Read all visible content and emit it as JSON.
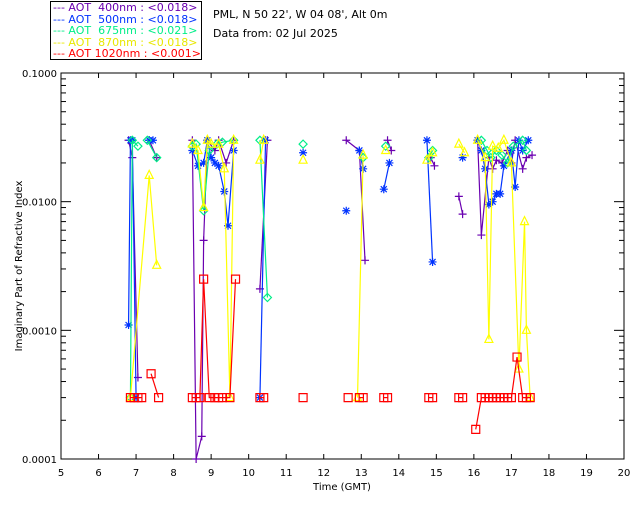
{
  "header": {
    "location": "PML, N 50 22', W 04 08', Alt 0m",
    "date": "Data from: 02 Jul 2025"
  },
  "chart_data": {
    "type": "line",
    "xlabel": "Time (GMT)",
    "ylabel": "Imaginary Part of Refractive Index",
    "xlim": [
      5,
      20
    ],
    "ylim": [
      0.0001,
      0.1
    ],
    "yscale": "log",
    "x_ticks": [
      "5",
      "6",
      "7",
      "8",
      "9",
      "10",
      "11",
      "12",
      "13",
      "14",
      "15",
      "16",
      "17",
      "18",
      "19",
      "20"
    ],
    "y_ticks": [
      "0.0001",
      "0.0010",
      "0.0100",
      "0.1000"
    ],
    "grid": false,
    "legend_placement": "top-left outside",
    "series": [
      {
        "name": "AOT  400nm : <0.018>",
        "color": "#6a00b0",
        "marker": "plus",
        "points": [
          [
            6.8,
            0.03
          ],
          [
            6.9,
            0.022
          ],
          [
            7.05,
            0.00043
          ],
          null,
          [
            7.35,
            0.03
          ],
          [
            7.55,
            0.022
          ],
          null,
          [
            8.5,
            0.03
          ],
          [
            8.6,
            0.0001
          ],
          [
            8.75,
            0.00015
          ],
          [
            8.8,
            0.005
          ],
          [
            8.9,
            0.03
          ],
          [
            9.1,
            0.025
          ],
          [
            9.2,
            0.03
          ],
          [
            9.4,
            0.02
          ],
          [
            9.6,
            0.03
          ],
          null,
          [
            10.3,
            0.0021
          ],
          [
            10.5,
            0.03
          ],
          null,
          [
            12.6,
            0.03
          ],
          [
            12.95,
            0.025
          ],
          [
            13.1,
            0.0035
          ],
          null,
          [
            13.7,
            0.03
          ],
          [
            13.8,
            0.025
          ],
          null,
          [
            14.85,
            0.022
          ],
          [
            14.95,
            0.019
          ],
          null,
          [
            15.6,
            0.011
          ],
          [
            15.7,
            0.008
          ],
          null,
          [
            16.1,
            0.03
          ],
          [
            16.2,
            0.0055
          ],
          [
            16.4,
            0.022
          ],
          [
            16.5,
            0.018
          ],
          [
            16.6,
            0.021
          ],
          [
            16.75,
            0.02
          ],
          [
            16.9,
            0.025
          ],
          [
            17.0,
            0.02
          ],
          [
            17.1,
            0.03
          ],
          [
            17.3,
            0.018
          ],
          [
            17.4,
            0.022
          ],
          [
            17.55,
            0.023
          ]
        ]
      },
      {
        "name": "AOT  500nm : <0.018>",
        "color": "#0033ff",
        "marker": "asterisk",
        "points": [
          [
            6.8,
            0.0011
          ],
          [
            6.85,
            0.03
          ],
          [
            6.9,
            0.03
          ],
          [
            7.0,
            0.0003
          ],
          null,
          [
            7.35,
            0.03
          ],
          [
            7.45,
            0.03
          ],
          null,
          [
            8.5,
            0.025
          ],
          [
            8.65,
            0.019
          ],
          [
            8.8,
            0.02
          ],
          [
            8.9,
            0.03
          ],
          [
            9.0,
            0.022
          ],
          [
            9.1,
            0.02
          ],
          [
            9.2,
            0.019
          ],
          [
            9.35,
            0.012
          ],
          [
            9.45,
            0.0065
          ],
          [
            9.6,
            0.025
          ],
          null,
          [
            10.3,
            0.0003
          ],
          [
            10.45,
            0.03
          ],
          null,
          [
            11.45,
            0.024
          ],
          null,
          [
            12.6,
            0.0085
          ],
          null,
          [
            12.95,
            0.025
          ],
          [
            13.05,
            0.018
          ],
          null,
          [
            13.6,
            0.0125
          ],
          [
            13.75,
            0.02
          ],
          null,
          [
            14.75,
            0.03
          ],
          [
            14.9,
            0.0034
          ],
          null,
          [
            15.7,
            0.022
          ],
          null,
          [
            16.1,
            0.03
          ],
          [
            16.2,
            0.025
          ],
          [
            16.3,
            0.018
          ],
          [
            16.4,
            0.0095
          ],
          [
            16.5,
            0.01
          ],
          [
            16.6,
            0.0115
          ],
          [
            16.7,
            0.0115
          ],
          [
            16.8,
            0.019
          ],
          [
            17.0,
            0.025
          ],
          [
            17.1,
            0.013
          ],
          [
            17.2,
            0.03
          ],
          [
            17.3,
            0.025
          ],
          [
            17.45,
            0.03
          ]
        ]
      },
      {
        "name": "AOT  675nm : <0.021>",
        "color": "#00ee88",
        "marker": "diamond",
        "points": [
          [
            6.85,
            0.0003
          ],
          [
            6.9,
            0.03
          ],
          [
            7.05,
            0.027
          ],
          null,
          [
            7.3,
            0.03
          ],
          [
            7.55,
            0.022
          ],
          null,
          [
            8.5,
            0.027
          ],
          [
            8.6,
            0.028
          ],
          [
            8.8,
            0.0085
          ],
          [
            8.95,
            0.025
          ],
          [
            9.15,
            0.028
          ],
          [
            9.3,
            0.029
          ],
          [
            9.6,
            0.03
          ],
          null,
          [
            10.3,
            0.03
          ],
          [
            10.5,
            0.0018
          ],
          null,
          [
            11.45,
            0.028
          ],
          null,
          [
            13.05,
            0.022
          ],
          null,
          [
            13.65,
            0.027
          ],
          null,
          [
            14.8,
            0.022
          ],
          [
            14.9,
            0.025
          ],
          null,
          [
            16.2,
            0.03
          ],
          [
            16.35,
            0.025
          ],
          [
            16.45,
            0.022
          ],
          [
            16.6,
            0.025
          ],
          [
            16.75,
            0.023
          ],
          [
            16.9,
            0.02
          ],
          [
            17.05,
            0.027
          ],
          [
            17.3,
            0.03
          ],
          [
            17.4,
            0.025
          ]
        ]
      },
      {
        "name": "AOT  870nm : <0.018>",
        "color": "#ffff00",
        "marker": "triangle",
        "points": [
          [
            6.85,
            0.0003
          ],
          [
            7.35,
            0.016
          ],
          [
            7.55,
            0.0032
          ],
          null,
          [
            8.5,
            0.028
          ],
          [
            8.65,
            0.025
          ],
          [
            8.8,
            0.009
          ],
          [
            8.9,
            0.03
          ],
          [
            9.0,
            0.028
          ],
          [
            9.2,
            0.028
          ],
          [
            9.35,
            0.018
          ],
          [
            9.5,
            0.0003
          ],
          [
            9.6,
            0.03
          ],
          null,
          [
            10.3,
            0.021
          ],
          [
            10.4,
            0.03
          ],
          null,
          [
            11.45,
            0.021
          ],
          null,
          [
            12.9,
            0.0003
          ],
          [
            13.05,
            0.023
          ],
          null,
          [
            13.65,
            0.025
          ],
          null,
          [
            14.75,
            0.021
          ],
          [
            14.9,
            0.024
          ],
          null,
          [
            15.6,
            0.028
          ],
          [
            15.75,
            0.024
          ],
          null,
          [
            16.1,
            0.03
          ],
          [
            16.3,
            0.022
          ],
          [
            16.4,
            0.00085
          ],
          [
            16.5,
            0.027
          ],
          [
            16.65,
            0.026
          ],
          [
            16.8,
            0.03
          ],
          [
            17.0,
            0.02
          ],
          [
            17.2,
            0.0005
          ],
          [
            17.35,
            0.007
          ],
          [
            17.4,
            0.001
          ],
          [
            17.5,
            0.0003
          ]
        ]
      },
      {
        "name": "AOT 1020nm : <0.001>",
        "color": "#ff0000",
        "marker": "square",
        "points": [
          [
            6.85,
            0.0003
          ],
          [
            6.95,
            0.0003
          ],
          [
            7.05,
            0.0003
          ],
          [
            7.15,
            0.0003
          ],
          null,
          [
            7.4,
            0.00046
          ],
          [
            7.6,
            0.0003
          ],
          null,
          [
            8.5,
            0.0003
          ],
          [
            8.6,
            0.0003
          ],
          [
            8.7,
            0.0003
          ],
          [
            8.8,
            0.0025
          ],
          [
            8.95,
            0.0003
          ],
          [
            9.1,
            0.0003
          ],
          [
            9.2,
            0.0003
          ],
          [
            9.3,
            0.0003
          ],
          [
            9.5,
            0.0003
          ],
          [
            9.65,
            0.0025
          ],
          null,
          [
            10.3,
            0.0003
          ],
          [
            10.4,
            0.0003
          ],
          null,
          [
            11.45,
            0.0003
          ],
          null,
          [
            12.65,
            0.0003
          ],
          null,
          [
            12.95,
            0.0003
          ],
          [
            13.05,
            0.0003
          ],
          null,
          [
            13.6,
            0.0003
          ],
          [
            13.7,
            0.0003
          ],
          null,
          [
            14.8,
            0.0003
          ],
          [
            14.9,
            0.0003
          ],
          null,
          [
            15.6,
            0.0003
          ],
          [
            15.7,
            0.0003
          ],
          null,
          [
            16.05,
            0.00017
          ],
          [
            16.2,
            0.0003
          ],
          [
            16.3,
            0.0003
          ],
          [
            16.4,
            0.0003
          ],
          [
            16.5,
            0.0003
          ],
          [
            16.6,
            0.0003
          ],
          [
            16.7,
            0.0003
          ],
          [
            16.8,
            0.0003
          ],
          [
            16.9,
            0.0003
          ],
          [
            17.0,
            0.0003
          ],
          [
            17.15,
            0.00062
          ],
          [
            17.3,
            0.0003
          ],
          [
            17.4,
            0.0003
          ],
          [
            17.5,
            0.0003
          ]
        ]
      }
    ]
  }
}
